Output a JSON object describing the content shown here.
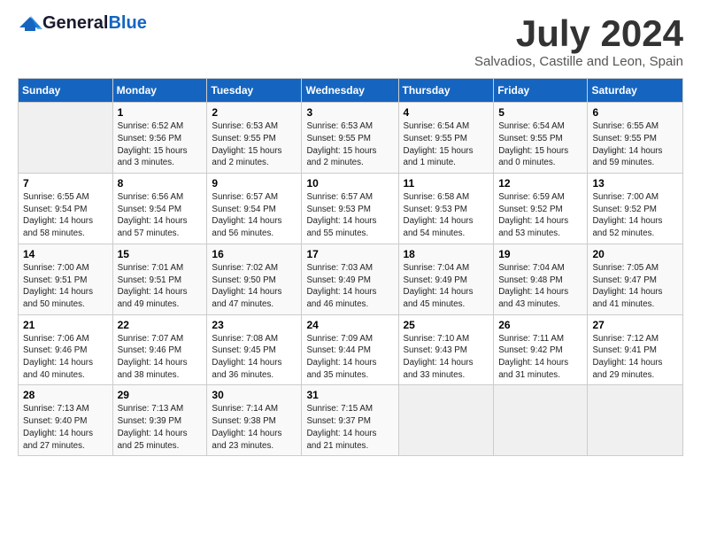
{
  "logo": {
    "general": "General",
    "blue": "Blue"
  },
  "title": "July 2024",
  "location": "Salvadios, Castille and Leon, Spain",
  "days": [
    "Sunday",
    "Monday",
    "Tuesday",
    "Wednesday",
    "Thursday",
    "Friday",
    "Saturday"
  ],
  "weeks": [
    [
      {
        "date": "",
        "info": ""
      },
      {
        "date": "1",
        "info": "Sunrise: 6:52 AM\nSunset: 9:56 PM\nDaylight: 15 hours\nand 3 minutes."
      },
      {
        "date": "2",
        "info": "Sunrise: 6:53 AM\nSunset: 9:55 PM\nDaylight: 15 hours\nand 2 minutes."
      },
      {
        "date": "3",
        "info": "Sunrise: 6:53 AM\nSunset: 9:55 PM\nDaylight: 15 hours\nand 2 minutes."
      },
      {
        "date": "4",
        "info": "Sunrise: 6:54 AM\nSunset: 9:55 PM\nDaylight: 15 hours\nand 1 minute."
      },
      {
        "date": "5",
        "info": "Sunrise: 6:54 AM\nSunset: 9:55 PM\nDaylight: 15 hours\nand 0 minutes."
      },
      {
        "date": "6",
        "info": "Sunrise: 6:55 AM\nSunset: 9:55 PM\nDaylight: 14 hours\nand 59 minutes."
      }
    ],
    [
      {
        "date": "7",
        "info": "Sunrise: 6:55 AM\nSunset: 9:54 PM\nDaylight: 14 hours\nand 58 minutes."
      },
      {
        "date": "8",
        "info": "Sunrise: 6:56 AM\nSunset: 9:54 PM\nDaylight: 14 hours\nand 57 minutes."
      },
      {
        "date": "9",
        "info": "Sunrise: 6:57 AM\nSunset: 9:54 PM\nDaylight: 14 hours\nand 56 minutes."
      },
      {
        "date": "10",
        "info": "Sunrise: 6:57 AM\nSunset: 9:53 PM\nDaylight: 14 hours\nand 55 minutes."
      },
      {
        "date": "11",
        "info": "Sunrise: 6:58 AM\nSunset: 9:53 PM\nDaylight: 14 hours\nand 54 minutes."
      },
      {
        "date": "12",
        "info": "Sunrise: 6:59 AM\nSunset: 9:52 PM\nDaylight: 14 hours\nand 53 minutes."
      },
      {
        "date": "13",
        "info": "Sunrise: 7:00 AM\nSunset: 9:52 PM\nDaylight: 14 hours\nand 52 minutes."
      }
    ],
    [
      {
        "date": "14",
        "info": "Sunrise: 7:00 AM\nSunset: 9:51 PM\nDaylight: 14 hours\nand 50 minutes."
      },
      {
        "date": "15",
        "info": "Sunrise: 7:01 AM\nSunset: 9:51 PM\nDaylight: 14 hours\nand 49 minutes."
      },
      {
        "date": "16",
        "info": "Sunrise: 7:02 AM\nSunset: 9:50 PM\nDaylight: 14 hours\nand 47 minutes."
      },
      {
        "date": "17",
        "info": "Sunrise: 7:03 AM\nSunset: 9:49 PM\nDaylight: 14 hours\nand 46 minutes."
      },
      {
        "date": "18",
        "info": "Sunrise: 7:04 AM\nSunset: 9:49 PM\nDaylight: 14 hours\nand 45 minutes."
      },
      {
        "date": "19",
        "info": "Sunrise: 7:04 AM\nSunset: 9:48 PM\nDaylight: 14 hours\nand 43 minutes."
      },
      {
        "date": "20",
        "info": "Sunrise: 7:05 AM\nSunset: 9:47 PM\nDaylight: 14 hours\nand 41 minutes."
      }
    ],
    [
      {
        "date": "21",
        "info": "Sunrise: 7:06 AM\nSunset: 9:46 PM\nDaylight: 14 hours\nand 40 minutes."
      },
      {
        "date": "22",
        "info": "Sunrise: 7:07 AM\nSunset: 9:46 PM\nDaylight: 14 hours\nand 38 minutes."
      },
      {
        "date": "23",
        "info": "Sunrise: 7:08 AM\nSunset: 9:45 PM\nDaylight: 14 hours\nand 36 minutes."
      },
      {
        "date": "24",
        "info": "Sunrise: 7:09 AM\nSunset: 9:44 PM\nDaylight: 14 hours\nand 35 minutes."
      },
      {
        "date": "25",
        "info": "Sunrise: 7:10 AM\nSunset: 9:43 PM\nDaylight: 14 hours\nand 33 minutes."
      },
      {
        "date": "26",
        "info": "Sunrise: 7:11 AM\nSunset: 9:42 PM\nDaylight: 14 hours\nand 31 minutes."
      },
      {
        "date": "27",
        "info": "Sunrise: 7:12 AM\nSunset: 9:41 PM\nDaylight: 14 hours\nand 29 minutes."
      }
    ],
    [
      {
        "date": "28",
        "info": "Sunrise: 7:13 AM\nSunset: 9:40 PM\nDaylight: 14 hours\nand 27 minutes."
      },
      {
        "date": "29",
        "info": "Sunrise: 7:13 AM\nSunset: 9:39 PM\nDaylight: 14 hours\nand 25 minutes."
      },
      {
        "date": "30",
        "info": "Sunrise: 7:14 AM\nSunset: 9:38 PM\nDaylight: 14 hours\nand 23 minutes."
      },
      {
        "date": "31",
        "info": "Sunrise: 7:15 AM\nSunset: 9:37 PM\nDaylight: 14 hours\nand 21 minutes."
      },
      {
        "date": "",
        "info": ""
      },
      {
        "date": "",
        "info": ""
      },
      {
        "date": "",
        "info": ""
      }
    ]
  ]
}
